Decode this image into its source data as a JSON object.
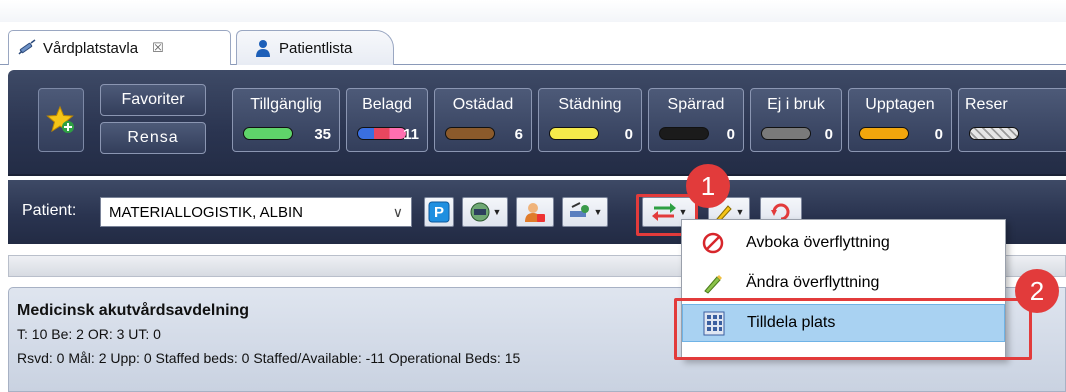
{
  "tabs": [
    {
      "label": "Vårdplatstavla",
      "close": "☒"
    },
    {
      "label": "Patientlista"
    }
  ],
  "status_bar": {
    "favorites_label": "Favoriter",
    "clear_label": "Rensa",
    "tiles": [
      {
        "label": "Tillgänglig",
        "count": "35",
        "color": "#5fd46a"
      },
      {
        "label": "Belagd",
        "count": "11",
        "color": "#e8475f"
      },
      {
        "label": "Ostädad",
        "count": "6",
        "color": "#8b5a2b"
      },
      {
        "label": "Städning",
        "count": "0",
        "color": "#f5ea4a"
      },
      {
        "label": "Spärrad",
        "count": "0",
        "color": "#1b1b1b"
      },
      {
        "label": "Ej i bruk",
        "count": "0",
        "color": "#7a7a7a"
      },
      {
        "label": "Upptagen",
        "count": "0",
        "color": "#f2a60c"
      },
      {
        "label": "Reser",
        "count": "",
        "color": "#d9d9d9"
      }
    ]
  },
  "patient_bar": {
    "label": "Patient:",
    "selected_patient": "MATERIALLOGISTIK, ALBIN"
  },
  "context_menu": {
    "items": [
      {
        "label": "Avboka överflyttning",
        "icon": "cancel-icon"
      },
      {
        "label": "Ändra överflyttning",
        "icon": "pencil-icon"
      },
      {
        "label": "Tilldela plats",
        "icon": "building-icon"
      }
    ]
  },
  "ward_panel": {
    "title": "Medicinsk akutvårdsavdelning",
    "line1": "T: 10 Be: 2 OR: 3 UT: 0",
    "line2": "Rsvd: 0 Mål: 2 Upp: 0 Staffed beds: 0 Staffed/Available: -11 Operational Beds: 15"
  },
  "callouts": {
    "first": "1",
    "second": "2"
  },
  "colors": {
    "highlight": "#e23b3b",
    "menu_selected": "#a9d2f2",
    "bar_dark": "#2a3450"
  }
}
